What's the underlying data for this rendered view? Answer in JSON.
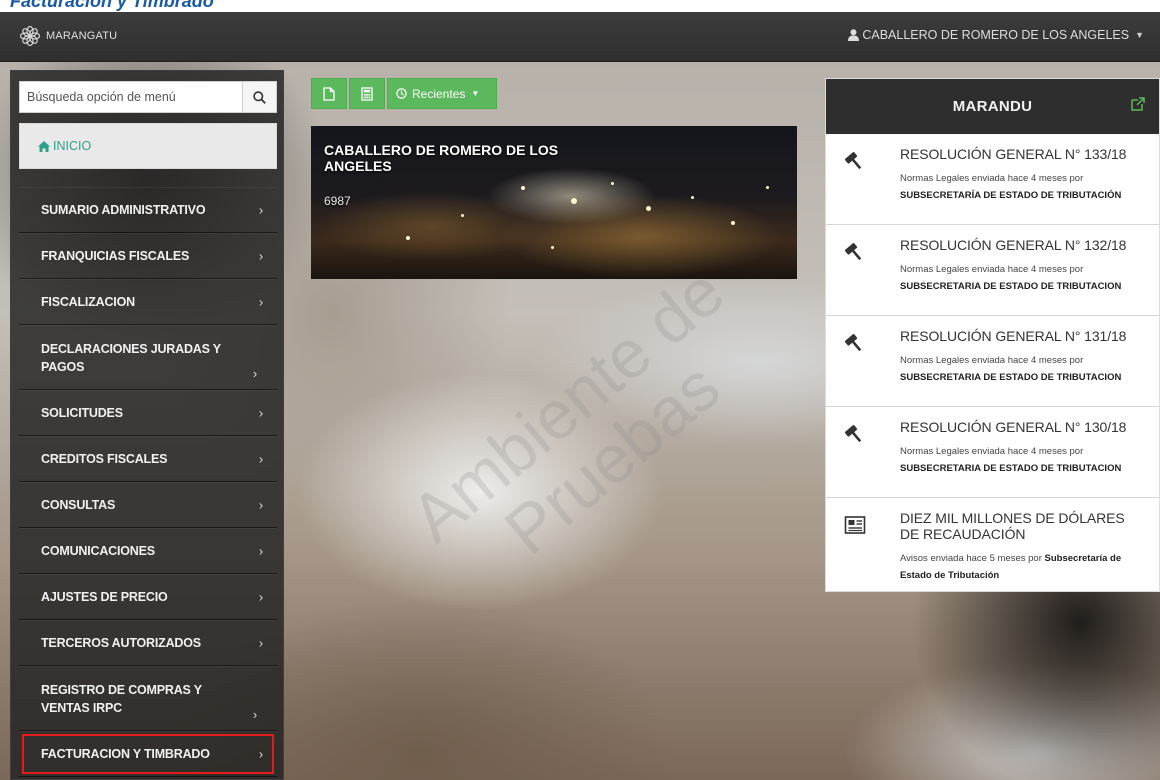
{
  "doc_title": "Facturación y Timbrado",
  "navbar": {
    "brand": "MARANGATU",
    "user": "CABALLERO DE ROMERO DE LOS ANGELES"
  },
  "sidebar": {
    "search_placeholder": "Búsqueda opción de menú",
    "inicio": "INICIO",
    "items": [
      {
        "label": "SUMARIO ADMINISTRATIVO"
      },
      {
        "label": "FRANQUICIAS FISCALES"
      },
      {
        "label": "FISCALIZACION"
      },
      {
        "label": "DECLARACIONES JURADAS Y PAGOS"
      },
      {
        "label": "SOLICITUDES"
      },
      {
        "label": "CREDITOS FISCALES"
      },
      {
        "label": "CONSULTAS"
      },
      {
        "label": "COMUNICACIONES"
      },
      {
        "label": "AJUSTES DE PRECIO"
      },
      {
        "label": "TERCEROS AUTORIZADOS"
      },
      {
        "label": "REGISTRO DE COMPRAS Y VENTAS IRPC"
      },
      {
        "label": "FACTURACION Y TIMBRADO"
      }
    ],
    "chevron": "›"
  },
  "toolbar": {
    "recientes": "Recientes"
  },
  "hero": {
    "title": "CABALLERO DE ROMERO DE LOS ANGELES",
    "ruc": "6987"
  },
  "watermark": {
    "line1": "Ambiente de",
    "line2": "Pruebas"
  },
  "panel": {
    "title": "MARANDU",
    "items": [
      {
        "icon": "gavel-icon",
        "title": "RESOLUCIÓN GENERAL N° 133/18",
        "meta_prefix": "Normas Legales enviada hace 4 meses por",
        "author": "SUBSECRETARÍA DE ESTADO DE TRIBUTACIÓN"
      },
      {
        "icon": "gavel-icon",
        "title": "RESOLUCIÓN GENERAL N° 132/18",
        "meta_prefix": "Normas Legales enviada hace 4 meses por",
        "author": "SUBSECRETARIA DE ESTADO DE TRIBUTACION"
      },
      {
        "icon": "gavel-icon",
        "title": "RESOLUCIÓN GENERAL N° 131/18",
        "meta_prefix": "Normas Legales enviada hace 4 meses por",
        "author": "SUBSECRETARIA DE ESTADO DE TRIBUTACION"
      },
      {
        "icon": "gavel-icon",
        "title": "RESOLUCIÓN GENERAL N° 130/18",
        "meta_prefix": "Normas Legales enviada hace 4 meses por",
        "author": "SUBSECRETARIA DE ESTADO DE TRIBUTACION"
      },
      {
        "icon": "newspaper-icon",
        "title": "DIEZ MIL MILLONES DE DÓLARES DE RECAUDACIÓN",
        "meta_prefix": "Avisos enviada hace 5 meses por",
        "author": "Subsecretaría de Estado de Tributación"
      }
    ]
  },
  "colors": {
    "accent_green": "#5cb85c",
    "inicio_text": "#2ea089",
    "highlight_red": "#e21b1b",
    "navbar": "#333333"
  }
}
